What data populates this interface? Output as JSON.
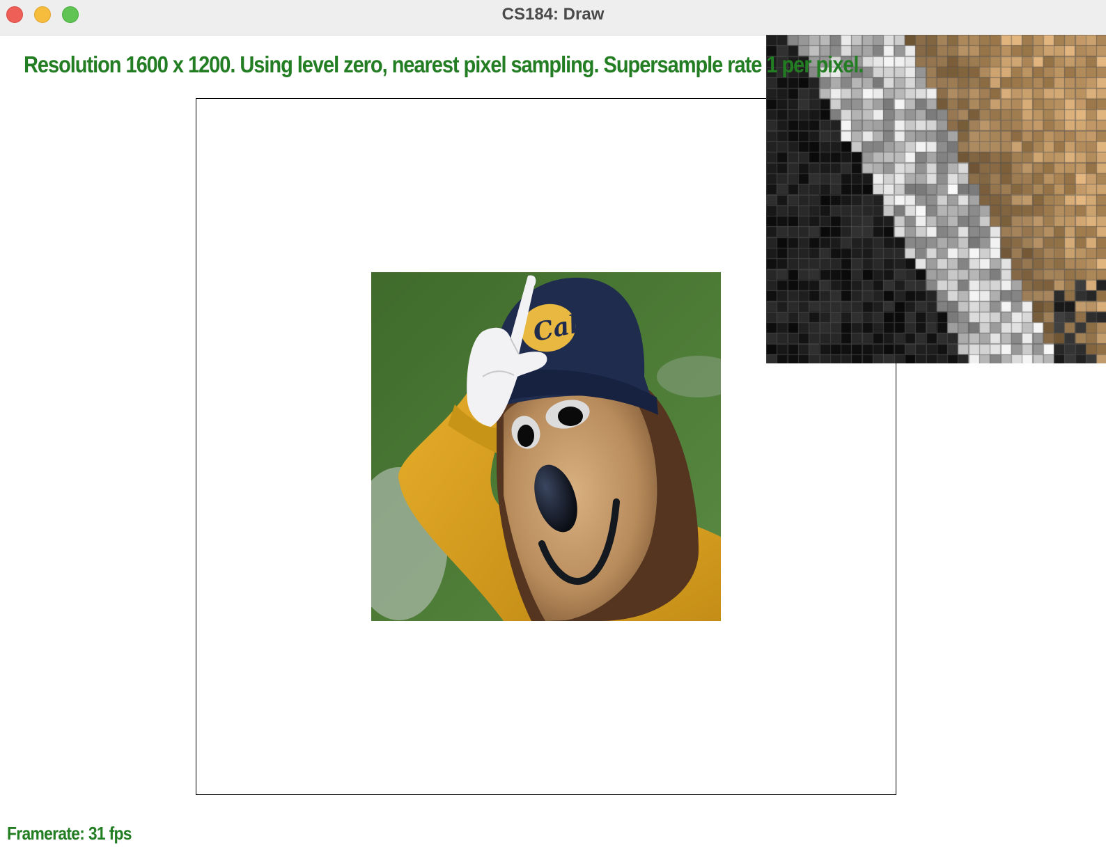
{
  "window": {
    "title": "CS184: Draw"
  },
  "status": {
    "message": "Resolution 1600 x 1200. Using level zero, nearest pixel sampling. Supersample rate 1 per pixel.",
    "framerate": "Framerate: 31 fps"
  },
  "texture": {
    "cap_logo_text": "Cal",
    "colors": {
      "background_green": "#4a7a33",
      "beanie_navy": "#1f2c4e",
      "logo_gold": "#e8b840",
      "sweater_gold": "#e0a722",
      "fur_tan": "#c59a6a",
      "fur_brown": "#5a3a22",
      "nose_black": "#10141c",
      "glove_white": "#f2f2f4"
    }
  },
  "zoom_inset": {
    "colors": {
      "dark": "#0e0e0e",
      "light_gray": "#d8d8d8",
      "tan": "#c8a478"
    }
  }
}
